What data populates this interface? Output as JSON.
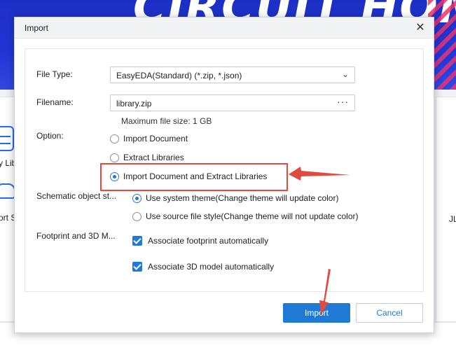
{
  "background": {
    "banner_text": "CIRCUIT HOME",
    "left_tiles": [
      "y Lib",
      "ort S"
    ],
    "right_tile": "JL"
  },
  "dialog": {
    "title": "Import",
    "close_icon": "close-icon",
    "file_type": {
      "label": "File Type:",
      "value": "EasyEDA(Standard) (*.zip, *.json)"
    },
    "filename": {
      "label": "Filename:",
      "value": "library.zip",
      "browse_label": "···"
    },
    "max_size_hint": "Maximum file size: 1 GB",
    "option": {
      "label": "Option:",
      "choices": [
        {
          "label": "Import Document",
          "checked": false
        },
        {
          "label": "Extract Libraries",
          "checked": false
        },
        {
          "label": "Import Document and Extract Libraries",
          "checked": true
        }
      ]
    },
    "schematic_style": {
      "label": "Schematic object st...",
      "choices": [
        {
          "label": "Use system theme(Change theme will update color)",
          "checked": true
        },
        {
          "label": "Use source file style(Change theme will not update color)",
          "checked": false
        }
      ]
    },
    "footprint_3d": {
      "label": "Footprint and 3D M...",
      "checks": [
        {
          "label": "Associate footprint automatically",
          "checked": true
        },
        {
          "label": "Associate 3D model automatically",
          "checked": true
        }
      ]
    },
    "buttons": {
      "import": "Import",
      "cancel": "Cancel"
    }
  },
  "colors": {
    "accent": "#1f7ad6",
    "annotation": "#e04a3f",
    "banner": "#2336d6"
  }
}
